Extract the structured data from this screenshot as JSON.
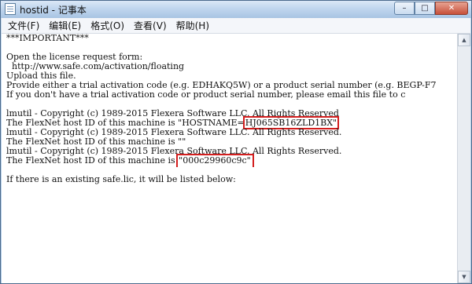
{
  "window": {
    "title": "hostid - 记事本",
    "icon": "notepad-icon",
    "controls": {
      "minimize": "–",
      "maximize": "□",
      "close": "✕"
    }
  },
  "menu": [
    "文件(F)",
    "编辑(E)",
    "格式(O)",
    "查看(V)",
    "帮助(H)"
  ],
  "document": {
    "lines": [
      "***IMPORTANT***",
      "",
      "Open the license request form:",
      "  http://www.safe.com/activation/floating",
      "Upload this file.",
      "Provide either a trial activation code (e.g. EDHAKQ5W) or a product serial number (e.g. BEGP-F7",
      "If you don't have a trial activation code or product serial number, please email this file to c",
      "",
      "lmutil - Copyright (c) 1989-2015 Flexera Software LLC. All Rights Reserved"
    ],
    "hostid_line_prefix": "The FlexNet host ID of this machine is \"HOSTNAME=",
    "hostid_value": "HJ065SB16ZLD1BX\"",
    "lines_b": [
      "lmutil - Copyright (c) 1989-2015 Flexera Software LLC. All Rights Reserved.",
      "The FlexNet host ID of this machine is \"\"",
      "lmutil - Copyright (c) 1989-2015 Flexera Software LLC. All Rights Reserved."
    ],
    "mac_line_prefix": "The FlexNet host ID of this machine is ",
    "mac_value": "\"000c29960c9c\"",
    "lines_c": [
      "",
      "If there is an existing safe.lic, it will be listed below:"
    ]
  },
  "highlight_color": "#d31e1e"
}
